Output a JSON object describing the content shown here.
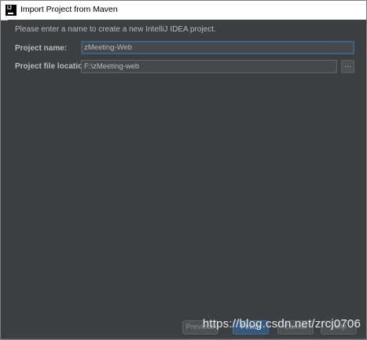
{
  "window": {
    "title": "Import Project from Maven",
    "icon": "intellij-idea-icon"
  },
  "form": {
    "instruction": "Please enter a name to create a new IntelliJ IDEA project.",
    "project_name_label": "Project name:",
    "project_name_value": "zMeeting-Web",
    "project_location_label": "Project file location:",
    "project_location_value": "F:\\zMeeting-web",
    "browse_label": "..."
  },
  "footer": {
    "previous_label": "Previous",
    "finish_label": "Finish",
    "cancel_label": "Cancel",
    "help_label": "Help"
  },
  "watermark": "https://blog.csdn.net/zrcj0706",
  "colors": {
    "panel_background": "#3c3f41",
    "field_background": "#45494a",
    "focus_border": "#3d6185",
    "text": "#bbbbbb"
  }
}
